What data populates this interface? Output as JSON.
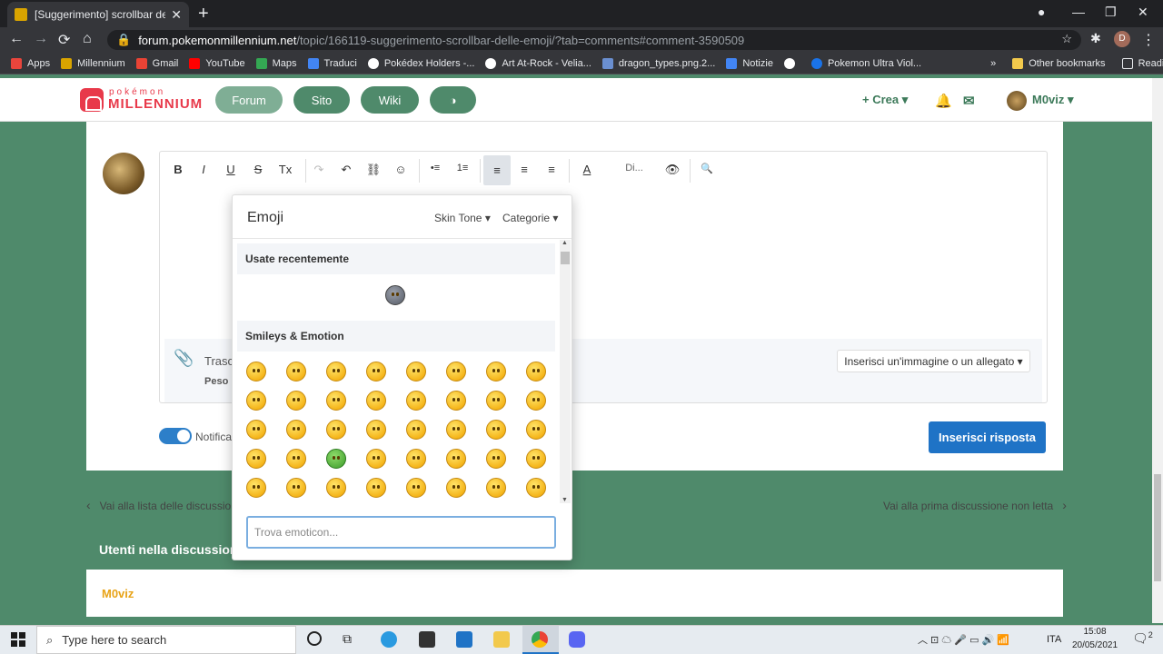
{
  "browser": {
    "tab_title": "[Suggerimento] scrollbar delle em",
    "url_domain": "forum.pokemonmillennium.net",
    "url_path": "/topic/166119-suggerimento-scrollbar-delle-emoji/?tab=comments#comment-3590509",
    "profile_initial": "D"
  },
  "bookmarks": [
    "Apps",
    "Millennium",
    "Gmail",
    "YouTube",
    "Maps",
    "Traduci",
    "Pokédex Holders -...",
    "Art At-Rock - Velia...",
    "dragon_types.png.2...",
    "Notizie",
    "",
    "Pokemon Ultra Viol..."
  ],
  "bookmark_more": "»",
  "other_bookmarks": "Other bookmarks",
  "reading_list": "Reading list",
  "site": {
    "logo_top": "pokémon",
    "logo_main": "MILLENNIUM",
    "nav": [
      "Forum",
      "Sito",
      "Wiki",
      "◑"
    ],
    "create": "+ Crea ▾",
    "user": "M0viz ▾",
    "accent": "#4f8a6b"
  },
  "editor": {
    "toolbar": [
      "B",
      "I",
      "U",
      "S",
      "Tx",
      "↷",
      "↶",
      "⛓",
      "☺",
      "•≡",
      "1≡",
      "≡",
      "≡",
      "≡",
      "A",
      "Di...",
      "👁",
      "🔍"
    ],
    "attach_text": "Trasc",
    "attach_sub": "Peso r",
    "attach_button": "Inserisci un'immagine o un allegato ▾",
    "notify_label": "Notifica",
    "submit": "Inserisci risposta"
  },
  "nav": {
    "back": "Vai alla lista delle discussion",
    "next": "Vai alla prima discussione non letta"
  },
  "users_panel": {
    "title": "Utenti nella discussion",
    "user": "M0viz"
  },
  "emoji_panel": {
    "title": "Emoji",
    "skin_tone": "Skin Tone ▾",
    "categories": "Categorie ▾",
    "recent_label": "Usate recentemente",
    "smileys_label": "Smileys & Emotion",
    "search_placeholder": "Trova emoticon..."
  },
  "taskbar": {
    "search_placeholder": "Type here to search",
    "lang": "ITA",
    "time": "15:08",
    "date": "20/05/2021",
    "notifications": "2"
  }
}
